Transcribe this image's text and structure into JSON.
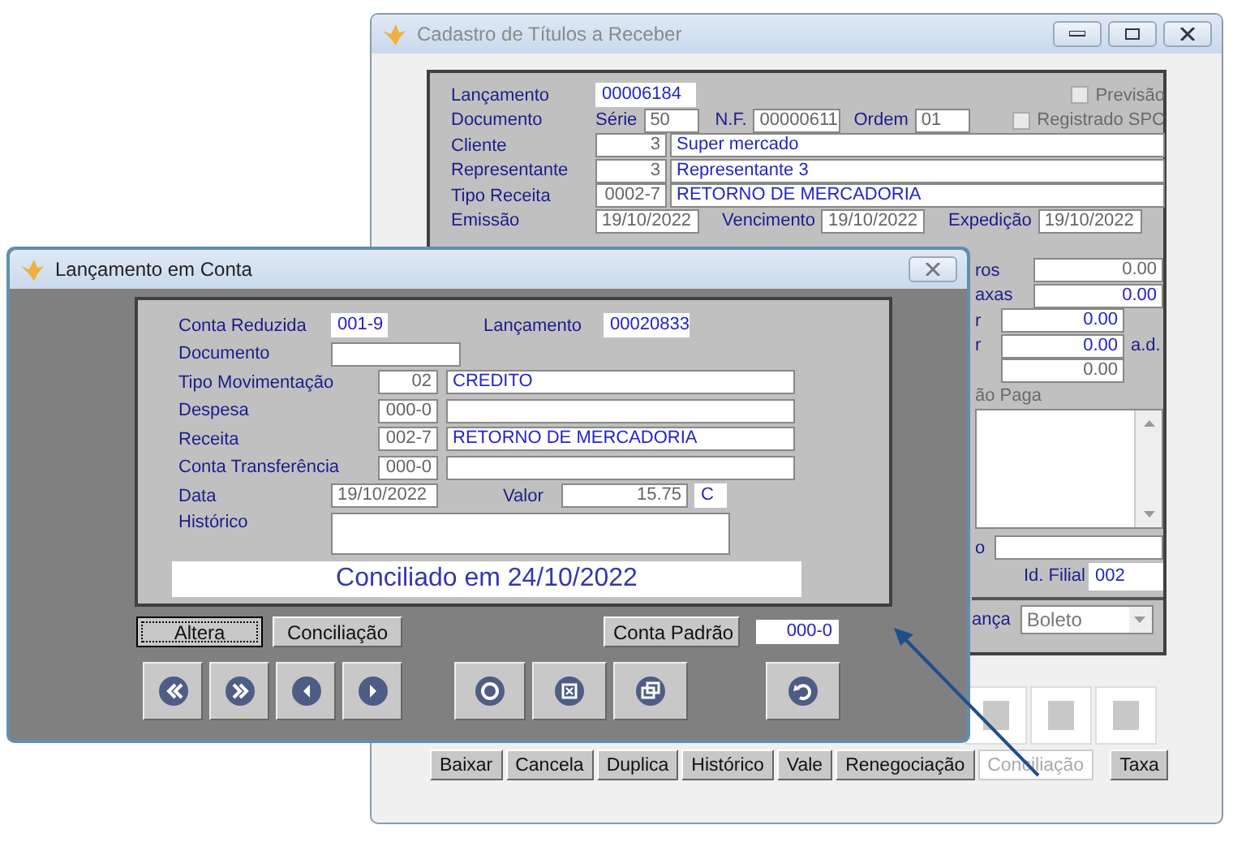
{
  "back_window": {
    "title": "Cadastro de Títulos a Receber",
    "lancamento": {
      "label": "Lançamento",
      "value": "00006184"
    },
    "documento": {
      "label": "Documento",
      "serie_label": "Série",
      "serie": "50",
      "nf_label": "N.F.",
      "nf": "00000611",
      "ordem_label": "Ordem",
      "ordem": "01"
    },
    "checkboxes": [
      {
        "label": "Previsão",
        "checked": false,
        "disabled": true
      },
      {
        "label": "Registrado SPC",
        "checked": false,
        "disabled": true
      }
    ],
    "rows": [
      {
        "label": "Cliente",
        "code": "3",
        "name": "Super mercado"
      },
      {
        "label": "Representante",
        "code": "3",
        "name": "Representante 3"
      },
      {
        "label": "Tipo Receita",
        "code": "0002-7",
        "name": "RETORNO DE MERCADORIA"
      }
    ],
    "dates": [
      {
        "label": "Emissão",
        "value": "19/10/2022"
      },
      {
        "label": "Vencimento",
        "value": "19/10/2022"
      },
      {
        "label": "Expedição",
        "value": "19/10/2022"
      }
    ],
    "right_fields": [
      {
        "label": "ros",
        "value": "0.00",
        "kind": "wide",
        "disabled": true
      },
      {
        "label": "axas",
        "value": "0.00",
        "kind": "wide",
        "disabled": false
      },
      {
        "label": "r",
        "value": "0.00",
        "kind": "short",
        "disabled": false
      },
      {
        "label": "r",
        "value": "0.00",
        "kind": "short",
        "disabled": false,
        "suffix": "a.d."
      },
      {
        "value": "0.00",
        "kind": "short",
        "disabled": true
      }
    ],
    "notes": {
      "label": "ão Paga"
    },
    "field_o": {
      "label": "o"
    },
    "filial": {
      "label": "Id. Filial",
      "value": "002"
    },
    "cobranca": {
      "label": "ança",
      "value": "Boleto"
    },
    "buttons": [
      {
        "label": "Baixar",
        "disabled": false
      },
      {
        "label": "Cancela",
        "disabled": false
      },
      {
        "label": "Duplica",
        "disabled": false
      },
      {
        "label": "Histórico",
        "disabled": false
      },
      {
        "label": "Vale",
        "disabled": false
      },
      {
        "label": "Renegociação",
        "disabled": false
      },
      {
        "label": "Conciliação",
        "disabled": true
      },
      {
        "label": "Taxa",
        "disabled": false
      }
    ]
  },
  "dialog": {
    "title": "Lançamento em Conta",
    "conta_reduzida": {
      "label": "Conta Reduzida",
      "value": "001-9"
    },
    "lancamento": {
      "label": "Lançamento",
      "value": "00020833"
    },
    "documento": {
      "label": "Documento"
    },
    "rows": [
      {
        "label": "Tipo Movimentação",
        "code": "02",
        "name": "CREDITO"
      },
      {
        "label": "Despesa",
        "code": "000-0"
      },
      {
        "label": "Receita",
        "code": "002-7",
        "name": "RETORNO DE MERCADORIA"
      },
      {
        "label": "Conta Transferência",
        "code": "000-0"
      }
    ],
    "data": {
      "label": "Data",
      "value": "19/10/2022"
    },
    "valor": {
      "label": "Valor",
      "value": "15.75",
      "type": "C"
    },
    "historico": {
      "label": "Histórico"
    },
    "status": "Conciliado em 24/10/2022",
    "buttons": [
      {
        "label": "Altera",
        "focused": true
      },
      {
        "label": "Conciliação",
        "focused": false
      }
    ],
    "conta_padrao": {
      "label": "Conta Padrão",
      "value": "000-0"
    }
  }
}
